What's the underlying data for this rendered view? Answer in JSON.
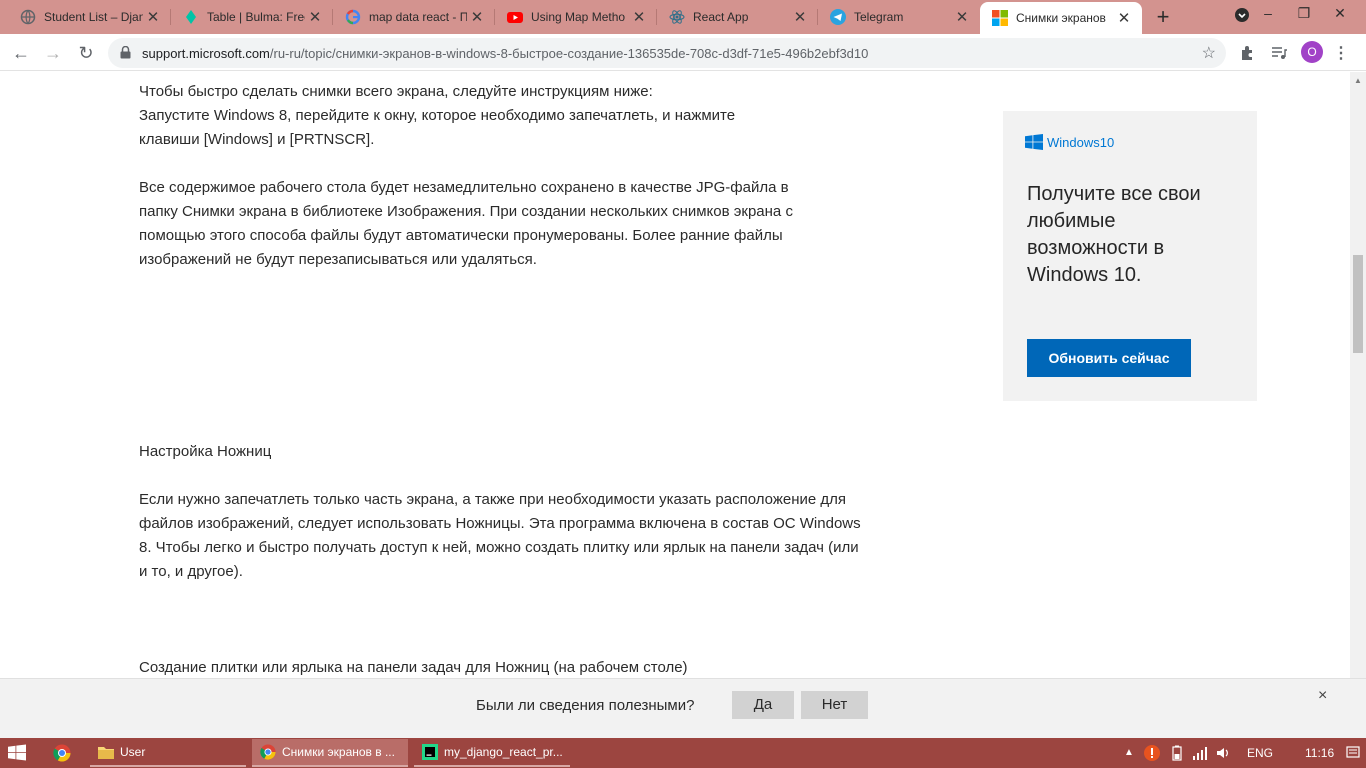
{
  "browser": {
    "tabs": [
      {
        "title": "Student List – Djan",
        "icon": "globe-icon"
      },
      {
        "title": "Table | Bulma: Free",
        "icon": "bulma-icon"
      },
      {
        "title": "map data react - П",
        "icon": "google-icon"
      },
      {
        "title": "Using Map Metho",
        "icon": "youtube-icon"
      },
      {
        "title": "React App",
        "icon": "react-icon"
      },
      {
        "title": "Telegram",
        "icon": "telegram-icon"
      },
      {
        "title": "Снимки экранов",
        "icon": "microsoft-icon",
        "active": true
      }
    ],
    "new_tab_label": "+",
    "url_domain": "support.microsoft.com",
    "url_path": "/ru-ru/topic/снимки-экранов-в-windows-8-быстрое-создание-136535de-708c-d3df-71e5-496b2ebf3d10",
    "avatar_letter": "O"
  },
  "article": {
    "p1": "Чтобы быстро сделать снимки всего экрана, следуйте инструкциям ниже:\nЗапустите Windows 8, перейдите к окну, которое необходимо запечатлеть, и нажмите\nклавиши [Windows] и [PRTNSCR].",
    "p2": "Все содержимое рабочего стола будет незамедлительно сохранено в качестве JPG-файла в\nпапку Снимки экрана в библиотеке Изображения. При создании нескольких снимков экрана с\nпомощью этого способа файлы будут автоматически пронумерованы. Более ранние файлы\nизображений не будут перезаписываться или удаляться.",
    "heading1": "Настройка Ножниц",
    "p3": "Если нужно запечатлеть только часть экрана, а также при необходимости указать расположение для\nфайлов изображений, следует использовать Ножницы. Эта программа включена в состав ОС Windows\n8. Чтобы легко и быстро получать доступ к ней, можно создать плитку или ярлык на панели задач (или\nи то, и другое).",
    "heading2": "Создание плитки или ярлыка на панели задач для Ножниц (на рабочем столе)"
  },
  "promo": {
    "logo_text": "Windows10",
    "text": "Получите все свои любимые возможности в Windows 10.",
    "button": "Обновить сейчас"
  },
  "feedback": {
    "question": "Были ли сведения полезными?",
    "yes": "Да",
    "no": "Нет",
    "close": "×"
  },
  "taskbar": {
    "items": [
      {
        "label": "User",
        "icon": "folder-icon"
      },
      {
        "label": "Снимки экранов в ...",
        "icon": "chrome-icon"
      },
      {
        "label": "my_django_react_pr...",
        "icon": "pycharm-icon"
      }
    ],
    "lang": "ENG",
    "time": "11:16"
  }
}
